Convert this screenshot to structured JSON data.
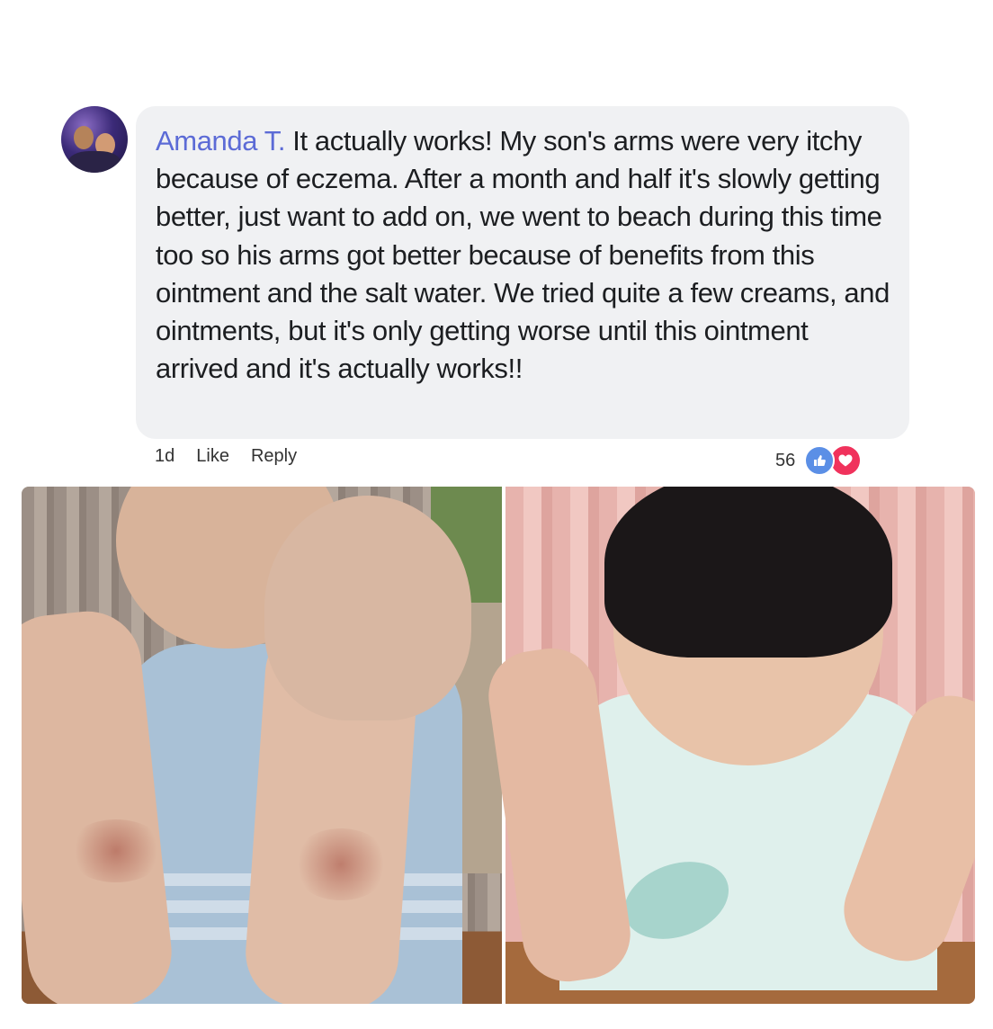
{
  "comment": {
    "author": "Amanda T.",
    "text": "It actually works! My son's arms were very itchy because of eczema. After a month and half it's slowly getting better, just want to add on, we went to beach during this time too so his arms got better because of benefits from this ointment and the salt water. We tried quite a few creams, and ointments, but it's only getting worse until this ointment arrived and it's actually works!!"
  },
  "actions": {
    "time": "1d",
    "like_label": "Like",
    "reply_label": "Reply"
  },
  "reactions": {
    "count": "56",
    "types": [
      "like-icon",
      "love-icon"
    ],
    "like_color": "#5b8fe6",
    "love_color": "#f0325c"
  },
  "colors": {
    "author": "#5c6bd6",
    "bubble": "#f0f1f3"
  }
}
